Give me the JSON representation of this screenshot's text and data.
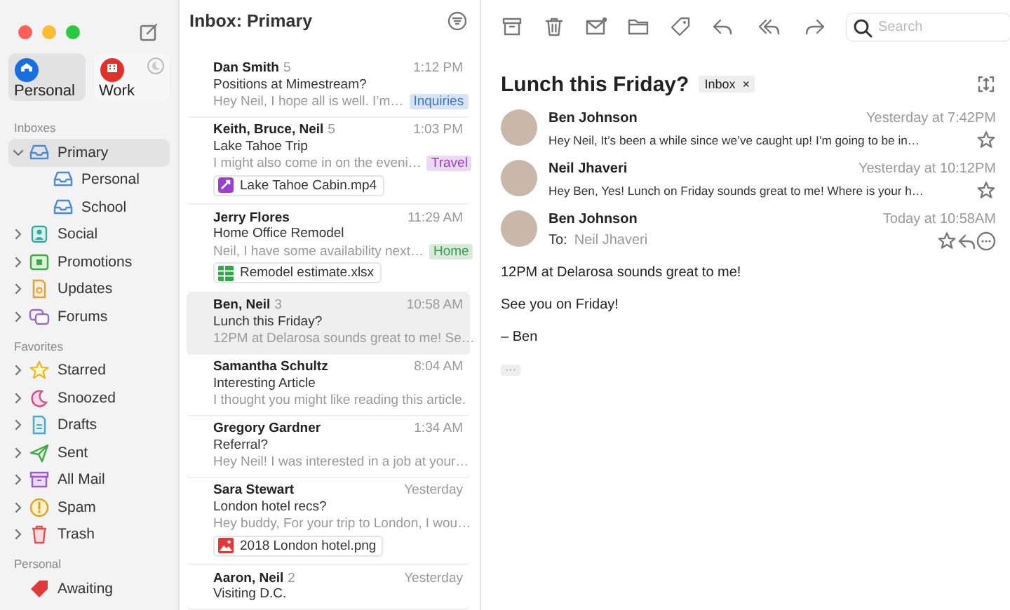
{
  "sidebar": {
    "accounts": [
      {
        "label": "Personal",
        "kind": "home",
        "selected": true
      },
      {
        "label": "Work",
        "kind": "work",
        "selected": false
      }
    ],
    "sections": [
      {
        "title": "Inboxes",
        "items": [
          {
            "label": "Primary",
            "kind": "inbox",
            "expanded": true,
            "selected": true,
            "children": [
              {
                "label": "Personal",
                "kind": "inbox",
                "selected": false
              },
              {
                "label": "School",
                "kind": "inbox",
                "selected": false
              }
            ]
          },
          {
            "label": "Social",
            "kind": "social",
            "expanded": false,
            "selected": false
          },
          {
            "label": "Promotions",
            "kind": "promotions",
            "expanded": false,
            "selected": false
          },
          {
            "label": "Updates",
            "kind": "updates",
            "expanded": false,
            "selected": false
          },
          {
            "label": "Forums",
            "kind": "forums",
            "expanded": false,
            "selected": false
          }
        ]
      },
      {
        "title": "Favorites",
        "items": [
          {
            "label": "Starred",
            "kind": "star",
            "expanded": false,
            "selected": false
          },
          {
            "label": "Snoozed",
            "kind": "snooze",
            "expanded": false,
            "selected": false
          },
          {
            "label": "Drafts",
            "kind": "draft",
            "expanded": false,
            "selected": false
          },
          {
            "label": "Sent",
            "kind": "sent",
            "expanded": false,
            "selected": false
          },
          {
            "label": "All Mail",
            "kind": "archive",
            "expanded": false,
            "selected": false
          },
          {
            "label": "Spam",
            "kind": "spam",
            "expanded": false,
            "selected": false
          },
          {
            "label": "Trash",
            "kind": "trash",
            "expanded": false,
            "selected": false
          }
        ]
      },
      {
        "title": "Personal",
        "items": [
          {
            "label": "Awaiting",
            "kind": "tag",
            "selected": false
          }
        ]
      }
    ]
  },
  "message_list": {
    "title": "Inbox: Primary",
    "messages": [
      {
        "sender": "Dan Smith",
        "count": "5",
        "time": "1:12 PM",
        "subject": "Positions at Mimestream?",
        "preview": "Hey Neil, I hope all is well. I’m…",
        "tag": {
          "label": "Inquiries",
          "color": "#3b78c4"
        },
        "selected": false
      },
      {
        "sender": "Keith, Bruce, Neil",
        "count": "5",
        "time": "1:03 PM",
        "subject": "Lake Tahoe Trip",
        "preview": "I might also come in on the eveni…",
        "tag": {
          "label": "Travel",
          "color": "#9a3fc0"
        },
        "attachment": {
          "name": "Lake Tahoe Cabin.mp4",
          "kind": "video"
        },
        "selected": false
      },
      {
        "sender": "Jerry Flores",
        "time": "11:29 AM",
        "subject": "Home Office Remodel",
        "preview": "Neil, I have some availability next…",
        "tag": {
          "label": "Home",
          "color": "#3a9a4a"
        },
        "attachment": {
          "name": "Remodel estimate.xlsx",
          "kind": "sheet"
        },
        "selected": false
      },
      {
        "sender": "Ben, Neil",
        "count": "3",
        "time": "10:58 AM",
        "subject": "Lunch this Friday?",
        "preview": "12PM at Delarosa sounds great to me! Se…",
        "selected": true
      },
      {
        "sender": "Samantha Schultz",
        "time": "8:04 AM",
        "subject": "Interesting Article",
        "preview": "I thought you might like reading this article.",
        "selected": false
      },
      {
        "sender": "Gregory Gardner",
        "time": "1:34 AM",
        "subject": "Referral?",
        "preview": "Hey Neil! I was interested in a job at your…",
        "selected": false
      },
      {
        "sender": "Sara Stewart",
        "time": "Yesterday",
        "subject": "London hotel recs?",
        "preview": "Hey buddy, For your trip to London, I wou…",
        "attachment": {
          "name": "2018 London hotel.png",
          "kind": "image"
        },
        "selected": false
      },
      {
        "sender": "Aaron, Neil",
        "count": "2",
        "time": "Yesterday",
        "subject": "Visiting D.C.",
        "selected": false
      }
    ]
  },
  "reader": {
    "search": {
      "placeholder": "Search"
    },
    "title": "Lunch this Friday?",
    "label": {
      "text": "Inbox",
      "remove": "×"
    },
    "thread": [
      {
        "kind": "collapsed",
        "sender": "Ben Johnson",
        "time": "Yesterday at 7:42PM",
        "preview": "Hey Neil, It’s been a while since we’ve caught up! I’m going to be in…"
      },
      {
        "kind": "collapsed",
        "sender": "Neil Jhaveri",
        "time": "Yesterday at 10:12PM",
        "preview": "Hey Ben, Yes! Lunch on Friday sounds great to me! Where is your h…"
      },
      {
        "kind": "expanded",
        "sender": "Ben Johnson",
        "time": "Today at 10:58AM",
        "to_label": "To:",
        "to": "Neil Jhaveri",
        "body": [
          "12PM at Delarosa sounds great to me!",
          "See you on Friday!",
          "– Ben"
        ],
        "more": "···"
      }
    ]
  }
}
